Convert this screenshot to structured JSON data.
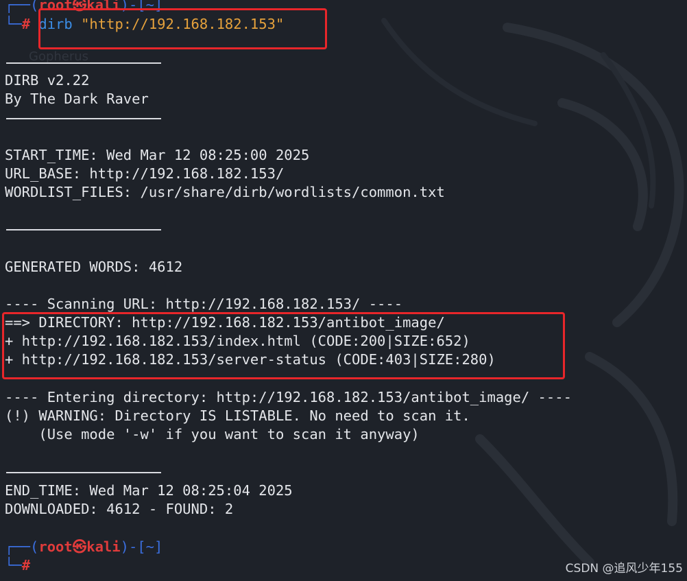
{
  "colors": {
    "background": "#1e2229",
    "text": "#e4e6ea",
    "prompt_frame": "#3b6fe0",
    "prompt_user": "#e03b3b",
    "command": "#3b8ee8",
    "argument": "#e6a23c",
    "highlight_box": "#e8262a"
  },
  "prompt_top": {
    "frame_left": "┌──(",
    "user": "root㉿kali",
    "frame_right": ")-[~]",
    "corner": "└─",
    "symbol": "#",
    "command": "dirb",
    "argument": "\"http://192.168.182.153\""
  },
  "background_text": "Gopherus",
  "banner": {
    "version": "DIRB v2.22",
    "author": "By The Dark Raver"
  },
  "info": {
    "start_time": "START_TIME: Wed Mar 12 08:25:00 2025",
    "url_base": "URL_BASE: http://192.168.182.153/",
    "wordlist": "WORDLIST_FILES: /usr/share/dirb/wordlists/common.txt"
  },
  "generated": "GENERATED WORDS: 4612",
  "scan": {
    "scanning": "---- Scanning URL: http://192.168.182.153/ ----",
    "results": [
      "==> DIRECTORY: http://192.168.182.153/antibot_image/",
      "+ http://192.168.182.153/index.html (CODE:200|SIZE:652)",
      "+ http://192.168.182.153/server-status (CODE:403|SIZE:280)"
    ],
    "entering": "---- Entering directory: http://192.168.182.153/antibot_image/ ----",
    "warning": "(!) WARNING: Directory IS LISTABLE. No need to scan it.",
    "hint": "    (Use mode '-w' if you want to scan it anyway)"
  },
  "summary": {
    "end_time": "END_TIME: Wed Mar 12 08:25:04 2025",
    "downloaded": "DOWNLOADED: 4612 - FOUND: 2"
  },
  "prompt_bottom": {
    "frame_left": "┌──(",
    "user": "root㉿kali",
    "frame_right": ")-[~]",
    "corner": "└─",
    "symbol": "#"
  },
  "watermark": "CSDN @追风少年155"
}
